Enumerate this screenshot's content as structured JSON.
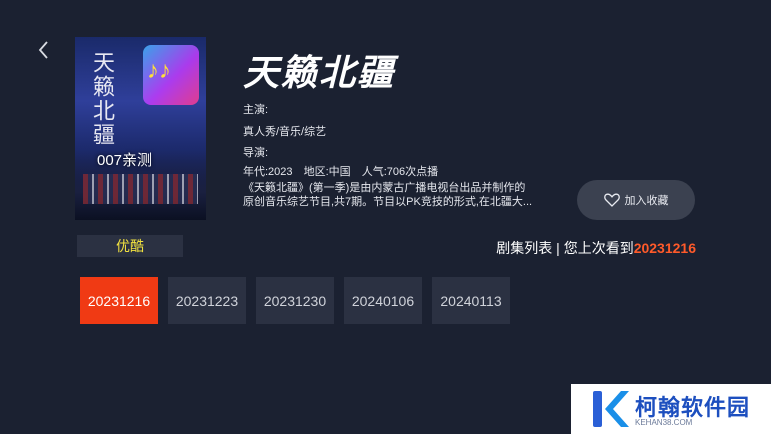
{
  "show": {
    "title": "天籁北疆",
    "starring": "主演:",
    "genre": "真人秀/音乐/综艺",
    "director": "导演:",
    "year": "年代:2023",
    "region": "地区:中国",
    "popularity": "人气:706次点播",
    "description_line1": "《天籁北疆》(第一季)是由内蒙古广播电视台出品并制作的",
    "description_line2": "原创音乐综艺节目,共7期。节目以PK竞技的形式,在北疆大..."
  },
  "poster": {
    "title": "天籁北疆",
    "badge": "007亲测"
  },
  "favorite": {
    "label": "加入收藏",
    "icon": "heart-icon"
  },
  "source": {
    "label": "优酷"
  },
  "episodes": {
    "header_prefix": "剧集列表 | 您上次看到",
    "last_watched": "20231216",
    "items": [
      "20231216",
      "20231223",
      "20231230",
      "20240106",
      "20240113"
    ],
    "active_index": 0
  },
  "watermark": {
    "text": "柯翰软件园",
    "sub": "KEHAN38.COM"
  },
  "colors": {
    "background": "#1b2131",
    "accent": "#f03a14",
    "source_tag_text": "#f2e240",
    "highlight_text": "#ff5a2a"
  }
}
